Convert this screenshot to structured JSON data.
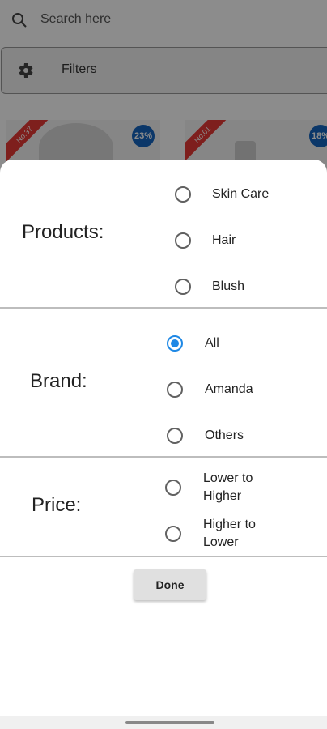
{
  "background": {
    "search_placeholder": "Search here",
    "filters_label": "Filters",
    "cards": [
      {
        "ribbon": "No.37",
        "discount": "23%"
      },
      {
        "ribbon": "No.01",
        "discount": "18%"
      }
    ]
  },
  "sheet": {
    "products": {
      "title": "Products:",
      "options": [
        "Skin Care",
        "Hair",
        "Blush"
      ]
    },
    "brand": {
      "title": "Brand:",
      "options": [
        "All",
        "Amanda",
        "Others"
      ],
      "selected": "All"
    },
    "price": {
      "title": "Price:",
      "options": [
        "Lower to Higher",
        "Higher to Lower"
      ]
    },
    "done_label": "Done"
  },
  "colors": {
    "accent": "#1e88e5",
    "ribbon": "#e53935",
    "badge": "#1565c0"
  }
}
